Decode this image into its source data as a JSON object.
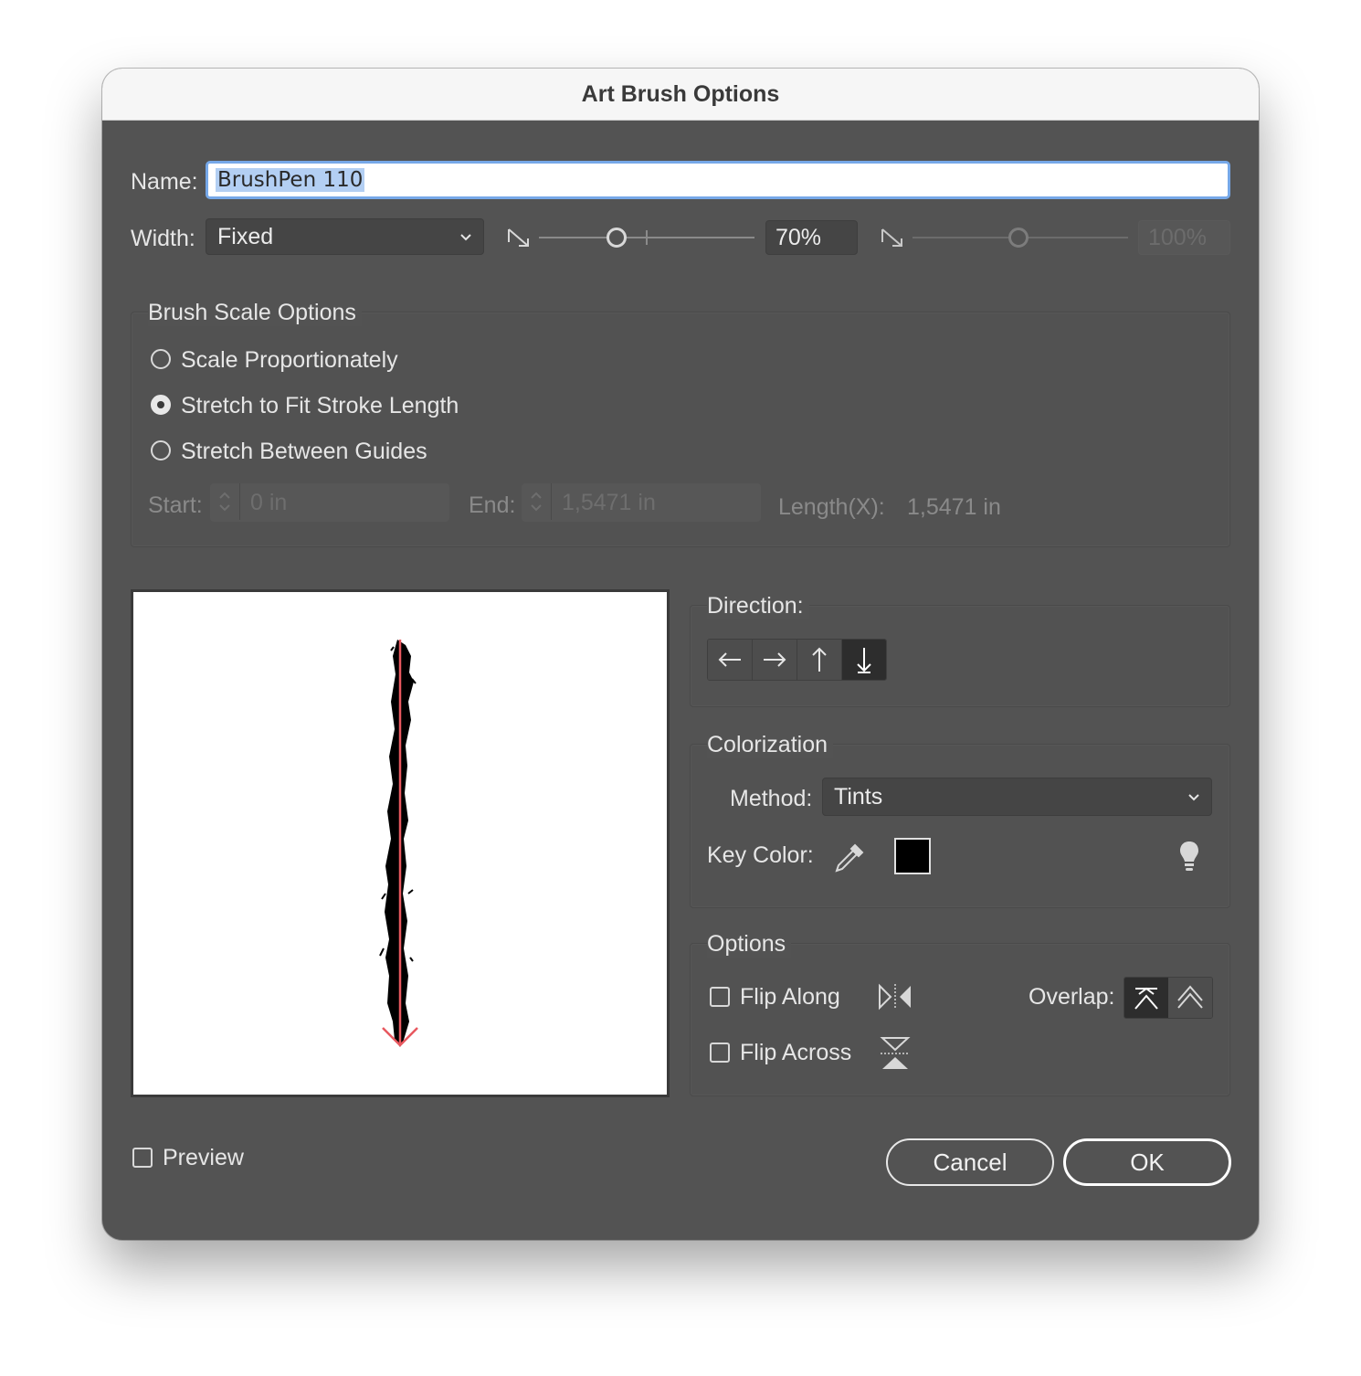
{
  "window": {
    "title": "Art Brush Options"
  },
  "name": {
    "label": "Name:",
    "value": "BrushPen 110"
  },
  "width": {
    "label": "Width:",
    "method": "Fixed",
    "percent": "70%",
    "variation_percent": "100%"
  },
  "scale_options": {
    "title": "Brush Scale Options",
    "options": [
      {
        "label": "Scale Proportionately",
        "selected": false
      },
      {
        "label": "Stretch to Fit Stroke Length",
        "selected": true
      },
      {
        "label": "Stretch Between Guides",
        "selected": false
      }
    ],
    "start_label": "Start:",
    "start_value": "0 in",
    "end_label": "End:",
    "end_value": "1,5471 in",
    "length_label": "Length(X):",
    "length_value": "1,5471 in"
  },
  "direction": {
    "title": "Direction:",
    "buttons": [
      {
        "icon": "arrow-left-icon"
      },
      {
        "icon": "arrow-right-icon"
      },
      {
        "icon": "arrow-up-icon"
      },
      {
        "icon": "arrow-down-icon",
        "active": true
      }
    ]
  },
  "colorization": {
    "title": "Colorization",
    "method_label": "Method:",
    "method_value": "Tints",
    "key_color_label": "Key Color:",
    "key_color": "#000000"
  },
  "options": {
    "title": "Options",
    "flip_along": "Flip Along",
    "flip_across": "Flip Across",
    "overlap_label": "Overlap:"
  },
  "footer": {
    "preview_label": "Preview",
    "cancel": "Cancel",
    "ok": "OK"
  },
  "colors": {
    "dialog_bg": "#535353",
    "accent": "#76a8e8",
    "direction_arrow": "#e8585f"
  }
}
